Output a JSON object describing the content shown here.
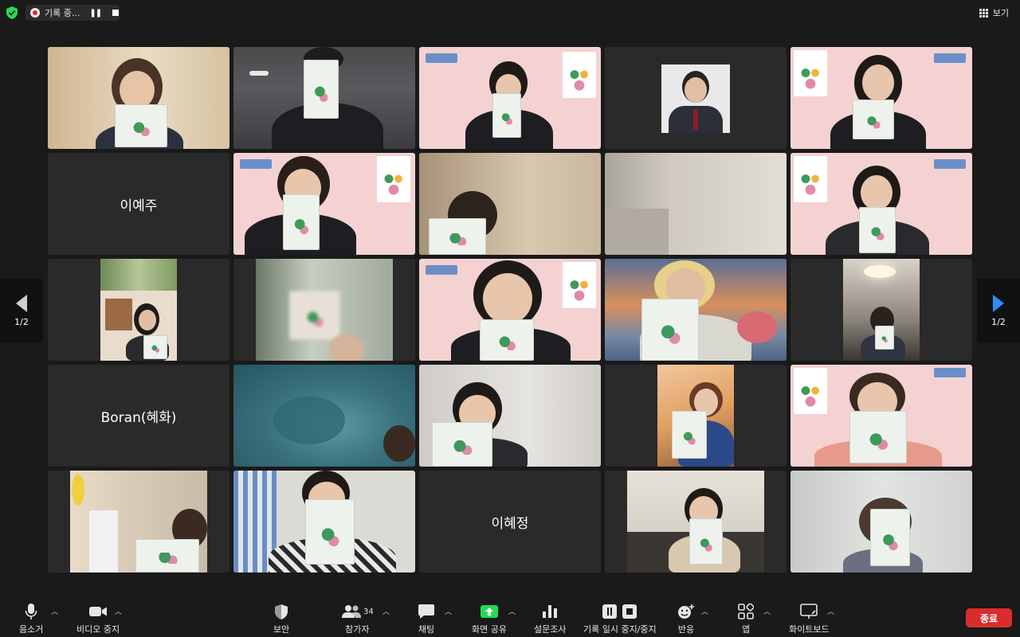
{
  "topbar": {
    "recording_label": "기록 중...",
    "view_label": "보기"
  },
  "pagination": {
    "left": "1/2",
    "right": "1/2"
  },
  "participants": [
    {
      "name": ""
    },
    {
      "name": ""
    },
    {
      "name": ""
    },
    {
      "name": ""
    },
    {
      "name": ""
    },
    {
      "name": "이예주"
    },
    {
      "name": ""
    },
    {
      "name": ""
    },
    {
      "name": ""
    },
    {
      "name": ""
    },
    {
      "name": ""
    },
    {
      "name": ""
    },
    {
      "name": ""
    },
    {
      "name": ""
    },
    {
      "name": ""
    },
    {
      "name": "Boran(혜화)"
    },
    {
      "name": ""
    },
    {
      "name": ""
    },
    {
      "name": ""
    },
    {
      "name": ""
    },
    {
      "name": ""
    },
    {
      "name": ""
    },
    {
      "name": "이혜정"
    },
    {
      "name": ""
    },
    {
      "name": ""
    }
  ],
  "toolbar": {
    "mute": "음소거",
    "stop_video": "비디오 중지",
    "security": "보안",
    "participants": "참가자",
    "participants_count": "34",
    "chat": "채팅",
    "share_screen": "화면 공유",
    "polls": "설문조사",
    "record": "기록 일시 중지/중지",
    "reactions": "반응",
    "apps": "앱",
    "whiteboard": "화이트보드",
    "end": "종료"
  },
  "colors": {
    "share_green": "#23d959",
    "end_red": "#d92d2d",
    "speaker_outline": "#23d959",
    "nav_arrow_blue": "#2d8cff"
  }
}
